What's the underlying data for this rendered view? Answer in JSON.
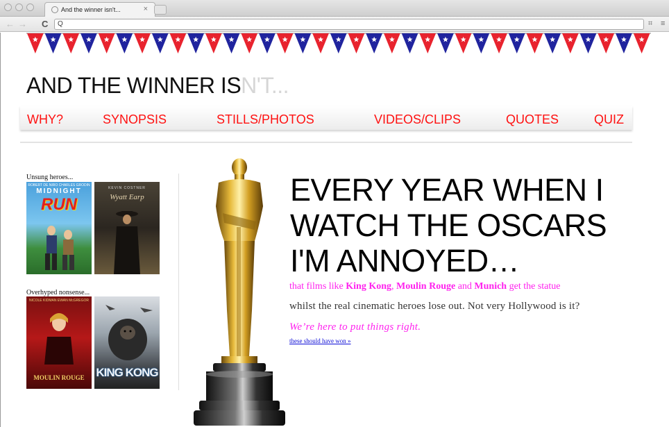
{
  "browser": {
    "tab_title": "And the winner isn't...",
    "tab_close": "×",
    "address_value": "",
    "back_glyph": "←",
    "forward_glyph": "→",
    "reload_glyph": "C",
    "search_glyph": "Q",
    "page_icon_glyph": "⌗",
    "menu_glyph": "≡"
  },
  "site": {
    "title_main": "AND THE WINNER IS",
    "title_faded": "N'T...",
    "bunting_colors": {
      "red": "#e8232e",
      "blue": "#20249e",
      "star": "#ffffff"
    }
  },
  "nav": {
    "items": [
      {
        "label": "WHY?"
      },
      {
        "label": "SYNOPSIS"
      },
      {
        "label": "STILLS/PHOTOS"
      },
      {
        "label": "VIDEOS/CLIPS"
      },
      {
        "label": "QUOTES"
      },
      {
        "label": "QUIZ"
      }
    ],
    "color": "#ff1111"
  },
  "sidebar": {
    "unsung_label": "Unsung heroes...",
    "overhyped_label": "Overhyped nonsense...",
    "posters": [
      {
        "title": "MIDNIGHT",
        "title2": "RUN",
        "credit": "ROBERT DE NIRO   CHARLES GRODIN"
      },
      {
        "title": "Wyatt Earp",
        "credit": "KEVIN COSTNER"
      },
      {
        "title": "MOULIN ROUGE",
        "credit": "NICOLE KIDMAN   EWAN McGREGOR"
      },
      {
        "title": "KING KONG"
      }
    ]
  },
  "hero": {
    "line1": "EVERY YEAR WHEN I",
    "line2": "WATCH THE OSCARS",
    "line3": "I'M ANNOYED…",
    "pink_prefix": "that films like ",
    "film1": "King Kong",
    "sep1": ", ",
    "film2": "Moulin Rouge",
    "sep2": " and ",
    "film3": "Munich",
    "pink_suffix": " get the statue",
    "grey_line": "whilst the real cinematic heroes lose out. Not very Hollywood is it?",
    "italic_line": "We’re here to put things right.",
    "link_text": "these should have won »"
  }
}
